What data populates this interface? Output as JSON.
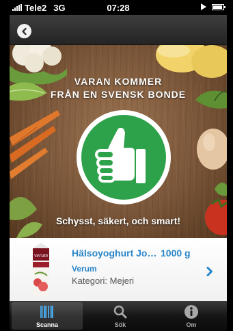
{
  "status_bar": {
    "carrier": "Tele2",
    "network": "3G",
    "time": "07:28"
  },
  "header": {
    "back_icon": "chevron-left-icon"
  },
  "hero": {
    "title_line1": "VARAN KOMMER",
    "title_line2": "FRÅN EN SVENSK BONDE",
    "tagline": "Schysst, säkert, och smart!",
    "badge_color": "#2ea24a",
    "badge_icon": "thumbs-up-icon"
  },
  "product": {
    "name": "Hälsoyoghurt Jord...",
    "size": "1000 g",
    "brand": "Verum",
    "category": "Kategori: Mejeri",
    "chevron_icon": "chevron-right-icon",
    "accent": "#2a86c8"
  },
  "tabbar": {
    "tabs": [
      {
        "label": "Scanna",
        "icon": "barcode-icon",
        "active": true
      },
      {
        "label": "Sök",
        "icon": "search-icon",
        "active": false
      },
      {
        "label": "Om",
        "icon": "info-icon",
        "active": false
      }
    ]
  }
}
